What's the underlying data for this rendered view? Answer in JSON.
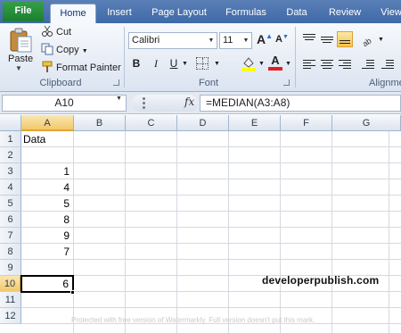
{
  "ribbon_tabs": [
    "File",
    "Home",
    "Insert",
    "Page Layout",
    "Formulas",
    "Data",
    "Review",
    "View"
  ],
  "active_tab": "Home",
  "clipboard": {
    "paste_label": "Paste",
    "cut_label": "Cut",
    "copy_label": "Copy",
    "format_painter_label": "Format Painter",
    "group_label": "Clipboard"
  },
  "font": {
    "name": "Calibri",
    "size": "11",
    "group_label": "Font",
    "bold": "B",
    "italic": "I",
    "underline": "U"
  },
  "alignment": {
    "group_label": "Alignme"
  },
  "formula_bar": {
    "name_box": "A10",
    "fx_label": "fx",
    "formula": "=MEDIAN(A3:A8)"
  },
  "columns": [
    "A",
    "B",
    "C",
    "D",
    "E",
    "F",
    "G"
  ],
  "selected_column": "A",
  "rows": [
    "1",
    "2",
    "3",
    "4",
    "5",
    "6",
    "7",
    "8",
    "9",
    "10",
    "11",
    "12"
  ],
  "selected_row": "10",
  "cells": {
    "A1": "Data",
    "A3": "1",
    "A4": "4",
    "A5": "5",
    "A6": "8",
    "A7": "9",
    "A8": "7",
    "A10": "6"
  },
  "brand_text": "developerpublish.com",
  "watermark_text": "Protected with free version of Watermarkly. Full version doesn't put this mark.",
  "colors": {
    "tab_bar": "#3e6aa8",
    "file_tab": "#1c7e2f",
    "selected_header": "#f2c86c"
  }
}
